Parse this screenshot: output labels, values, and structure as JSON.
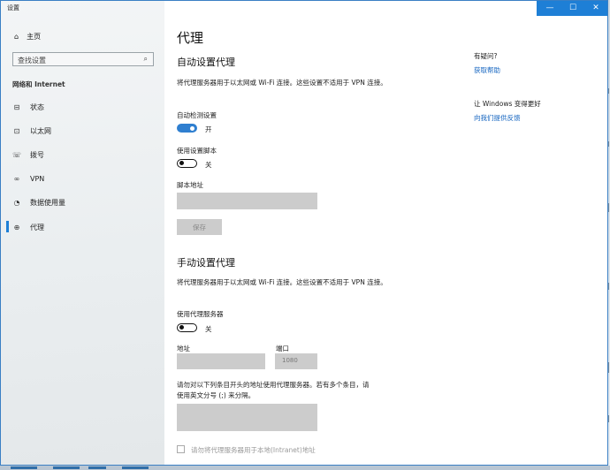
{
  "window": {
    "title": "设置",
    "minimize_glyph": "—",
    "maximize_glyph": "☐",
    "close_glyph": "✕",
    "accent": "#1e7fd6"
  },
  "sidebar": {
    "home_label": "主页",
    "search_placeholder": "查找设置",
    "section_label": "网络和 Internet",
    "items": [
      {
        "label": "状态",
        "icon": "status-icon"
      },
      {
        "label": "以太网",
        "icon": "ethernet-icon"
      },
      {
        "label": "拨号",
        "icon": "dialup-icon"
      },
      {
        "label": "VPN",
        "icon": "vpn-icon"
      },
      {
        "label": "数据使用量",
        "icon": "data-usage-icon"
      },
      {
        "label": "代理",
        "icon": "proxy-globe-icon"
      }
    ],
    "selected": "代理"
  },
  "main": {
    "title": "代理",
    "auto": {
      "heading": "自动设置代理",
      "description": "将代理服务器用于以太网或 Wi-Fi 连接。这些设置不适用于 VPN 连接。",
      "detect_label": "自动检测设置",
      "detect_state": "开",
      "script_label": "使用设置脚本",
      "script_state": "关",
      "address_label": "脚本地址",
      "address_value": "",
      "save_button": "保存"
    },
    "manual": {
      "heading": "手动设置代理",
      "description": "将代理服务器用于以太网或 Wi-Fi 连接。这些设置不适用于 VPN 连接。",
      "use_proxy_label": "使用代理服务器",
      "use_proxy_state": "关",
      "address_label": "地址",
      "address_value": "",
      "port_label": "端口",
      "port_value": "1080",
      "exceptions_desc_line1": "请勿对以下列条目开头的地址使用代理服务器。若有多个条目，请",
      "exceptions_desc_line2": "使用英文分号 (;) 来分隔。",
      "exceptions_value": "",
      "local_checkbox_label": "请勿将代理服务器用于本地(Intranet)地址",
      "local_checkbox_checked": false
    }
  },
  "aside": {
    "question_title": "有疑问?",
    "help_link": "获取帮助",
    "improve_title": "让 Windows 变得更好",
    "feedback_link": "向我们提供反馈"
  }
}
